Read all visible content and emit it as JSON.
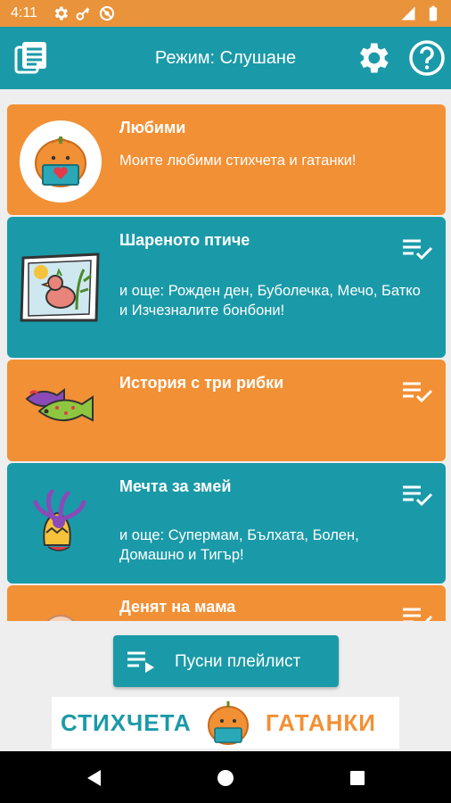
{
  "status_bar": {
    "time": "4:11",
    "icons": [
      "settings-icon",
      "key-icon",
      "blocked-icon"
    ],
    "right_icons": [
      "signal-icon",
      "battery-icon"
    ]
  },
  "app_bar": {
    "title": "Режим: Слушане",
    "left_icon": "library-icon",
    "right_icons": [
      "gear-icon",
      "help-icon"
    ]
  },
  "items": [
    {
      "title": "Любими",
      "subtitle": "Моите любими стихчета и гатанки!",
      "color": "#f29035"
    },
    {
      "title": "Шареното птиче",
      "subtitle": "и още: Рожден ден, Буболечка, Мечо, Батко и Изчезналите бонбони!",
      "color": "#1a9aa8"
    },
    {
      "title": "История с три рибки",
      "subtitle": "",
      "color": "#f29035"
    },
    {
      "title": "Мечта за змей",
      "subtitle": "и още: Супермам, Бълхата, Болен, Домашно и Тигър!",
      "color": "#1a9aa8"
    },
    {
      "title": "Денят на мама",
      "subtitle": "",
      "color": "#f29035"
    }
  ],
  "play_button": {
    "label": "Пусни плейлист"
  },
  "banner": {
    "left_text": "СТИХЧЕТА",
    "right_text": "ГАТАНКИ"
  },
  "colors": {
    "orange": "#f29035",
    "teal": "#1a9aa8",
    "status_orange": "#e9933a"
  },
  "nav_bar": {
    "icons": [
      "back-icon",
      "home-icon",
      "recents-icon"
    ]
  }
}
